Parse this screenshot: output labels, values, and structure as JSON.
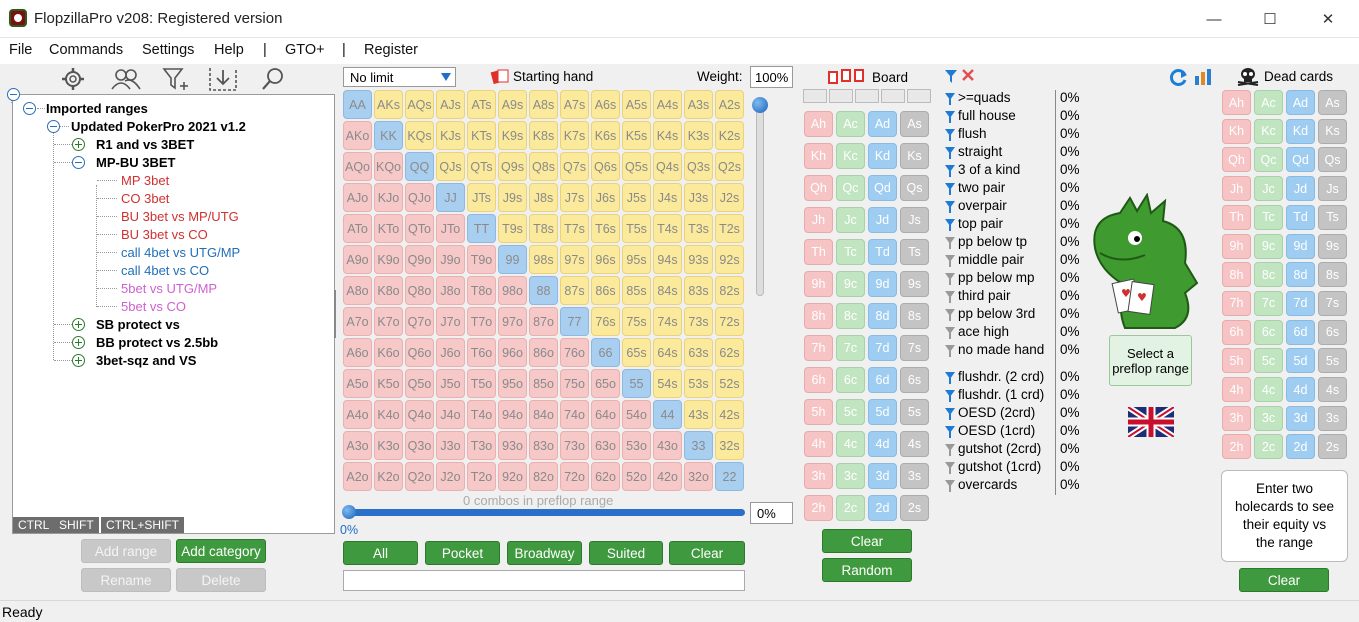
{
  "window": {
    "title": "FlopzillaPro v208: Registered version",
    "min": "—",
    "max": "☐",
    "close": "✕"
  },
  "menu": [
    "File",
    "Commands",
    "Settings",
    "Help",
    "|",
    "GTO+",
    "|",
    "Register"
  ],
  "toolbar_icons": [
    "gear-icon",
    "users-icon",
    "filter-plus-icon",
    "import-icon",
    "search-icon"
  ],
  "tree": {
    "root": "Imported ranges",
    "child": "Updated PokerPro 2021 v1.2",
    "items": [
      {
        "label": "R1 and vs 3BET",
        "color": "#000",
        "bold": true
      },
      {
        "label": "MP-BU 3BET",
        "color": "#000",
        "bold": true
      },
      {
        "label": "MP 3bet",
        "color": "#d03030"
      },
      {
        "label": "CO 3bet",
        "color": "#d03030"
      },
      {
        "label": "BU 3bet vs MP/UTG",
        "color": "#d03030"
      },
      {
        "label": "BU 3bet vs CO",
        "color": "#d03030"
      },
      {
        "label": "call 4bet vs UTG/MP",
        "color": "#1f6fb8"
      },
      {
        "label": "call 4bet vs CO",
        "color": "#1f6fb8"
      },
      {
        "label": "5bet vs UTG/MP",
        "color": "#d060d0"
      },
      {
        "label": "5bet vs CO",
        "color": "#d060d0"
      },
      {
        "label": "SB protect vs",
        "color": "#000",
        "bold": true
      },
      {
        "label": "BB protect vs 2.5bb",
        "color": "#000",
        "bold": true
      },
      {
        "label": "3bet-sqz and VS",
        "color": "#000",
        "bold": true
      }
    ]
  },
  "modifiers": [
    "CTRL",
    "SHIFT",
    "CTRL+SHIFT"
  ],
  "left_buttons": {
    "add_range": "Add range",
    "add_category": "Add category",
    "rename": "Rename",
    "delete": "Delete"
  },
  "range": {
    "limit": "No limit",
    "starting_hand": "Starting hand",
    "weight_label": "Weight:",
    "weight": "100%",
    "combos": "0 combos in preflop range",
    "progress": "0%",
    "percent": "0%"
  },
  "grid": [
    [
      "AA",
      "AKs",
      "AQs",
      "AJs",
      "ATs",
      "A9s",
      "A8s",
      "A7s",
      "A6s",
      "A5s",
      "A4s",
      "A3s",
      "A2s"
    ],
    [
      "AKo",
      "KK",
      "KQs",
      "KJs",
      "KTs",
      "K9s",
      "K8s",
      "K7s",
      "K6s",
      "K5s",
      "K4s",
      "K3s",
      "K2s"
    ],
    [
      "AQo",
      "KQo",
      "QQ",
      "QJs",
      "QTs",
      "Q9s",
      "Q8s",
      "Q7s",
      "Q6s",
      "Q5s",
      "Q4s",
      "Q3s",
      "Q2s"
    ],
    [
      "AJo",
      "KJo",
      "QJo",
      "JJ",
      "JTs",
      "J9s",
      "J8s",
      "J7s",
      "J6s",
      "J5s",
      "J4s",
      "J3s",
      "J2s"
    ],
    [
      "ATo",
      "KTo",
      "QTo",
      "JTo",
      "TT",
      "T9s",
      "T8s",
      "T7s",
      "T6s",
      "T5s",
      "T4s",
      "T3s",
      "T2s"
    ],
    [
      "A9o",
      "K9o",
      "Q9o",
      "J9o",
      "T9o",
      "99",
      "98s",
      "97s",
      "96s",
      "95s",
      "94s",
      "93s",
      "92s"
    ],
    [
      "A8o",
      "K8o",
      "Q8o",
      "J8o",
      "T8o",
      "98o",
      "88",
      "87s",
      "86s",
      "85s",
      "84s",
      "83s",
      "82s"
    ],
    [
      "A7o",
      "K7o",
      "Q7o",
      "J7o",
      "T7o",
      "97o",
      "87o",
      "77",
      "76s",
      "75s",
      "74s",
      "73s",
      "72s"
    ],
    [
      "A6o",
      "K6o",
      "Q6o",
      "J6o",
      "T6o",
      "96o",
      "86o",
      "76o",
      "66",
      "65s",
      "64s",
      "63s",
      "62s"
    ],
    [
      "A5o",
      "K5o",
      "Q5o",
      "J5o",
      "T5o",
      "95o",
      "85o",
      "75o",
      "65o",
      "55",
      "54s",
      "53s",
      "52s"
    ],
    [
      "A4o",
      "K4o",
      "Q4o",
      "J4o",
      "T4o",
      "94o",
      "84o",
      "74o",
      "64o",
      "54o",
      "44",
      "43s",
      "42s"
    ],
    [
      "A3o",
      "K3o",
      "Q3o",
      "J3o",
      "T3o",
      "93o",
      "83o",
      "73o",
      "63o",
      "53o",
      "43o",
      "33",
      "32s"
    ],
    [
      "A2o",
      "K2o",
      "Q2o",
      "J2o",
      "T2o",
      "92o",
      "82o",
      "72o",
      "62o",
      "52o",
      "42o",
      "32o",
      "22"
    ]
  ],
  "range_buttons": [
    "All",
    "Pocket",
    "Broadway",
    "Suited",
    "Clear"
  ],
  "board": {
    "label": "Board",
    "clear": "Clear",
    "random": "Random"
  },
  "ranks": [
    "A",
    "K",
    "Q",
    "J",
    "T",
    "9",
    "8",
    "7",
    "6",
    "5",
    "4",
    "3",
    "2"
  ],
  "suits": [
    "h",
    "c",
    "d",
    "s"
  ],
  "stats": [
    {
      "label": ">=quads",
      "val": "0%",
      "on": true
    },
    {
      "label": "full house",
      "val": "0%",
      "on": true
    },
    {
      "label": "flush",
      "val": "0%",
      "on": true
    },
    {
      "label": "straight",
      "val": "0%",
      "on": true
    },
    {
      "label": "3 of a kind",
      "val": "0%",
      "on": true
    },
    {
      "label": "two pair",
      "val": "0%",
      "on": true
    },
    {
      "label": "overpair",
      "val": "0%",
      "on": true
    },
    {
      "label": "top pair",
      "val": "0%",
      "on": true
    },
    {
      "label": "pp below tp",
      "val": "0%",
      "on": false
    },
    {
      "label": "middle pair",
      "val": "0%",
      "on": false
    },
    {
      "label": "pp below mp",
      "val": "0%",
      "on": false
    },
    {
      "label": "third pair",
      "val": "0%",
      "on": false
    },
    {
      "label": "pp below 3rd",
      "val": "0%",
      "on": false
    },
    {
      "label": "ace high",
      "val": "0%",
      "on": false
    },
    {
      "label": "no made hand",
      "val": "0%",
      "on": false
    }
  ],
  "draws": [
    {
      "label": "flushdr. (2 crd)",
      "val": "0%",
      "on": true
    },
    {
      "label": "flushdr. (1 crd)",
      "val": "0%",
      "on": true
    },
    {
      "label": "OESD (2crd)",
      "val": "0%",
      "on": true
    },
    {
      "label": "OESD (1crd)",
      "val": "0%",
      "on": true
    },
    {
      "label": "gutshot (2crd)",
      "val": "0%",
      "on": false
    },
    {
      "label": "gutshot (1crd)",
      "val": "0%",
      "on": false
    },
    {
      "label": "overcards",
      "val": "0%",
      "on": false
    }
  ],
  "center": {
    "select_range": "Select a preflop range"
  },
  "dead": {
    "label": "Dead cards",
    "info": "Enter two holecards to see their equity vs the range",
    "clear": "Clear"
  },
  "status": "Ready",
  "colors": {
    "green_btn": "#3f9a3f",
    "pair": "#a9cff0",
    "suited": "#fbe99c",
    "offsuit": "#f6c8c8"
  }
}
